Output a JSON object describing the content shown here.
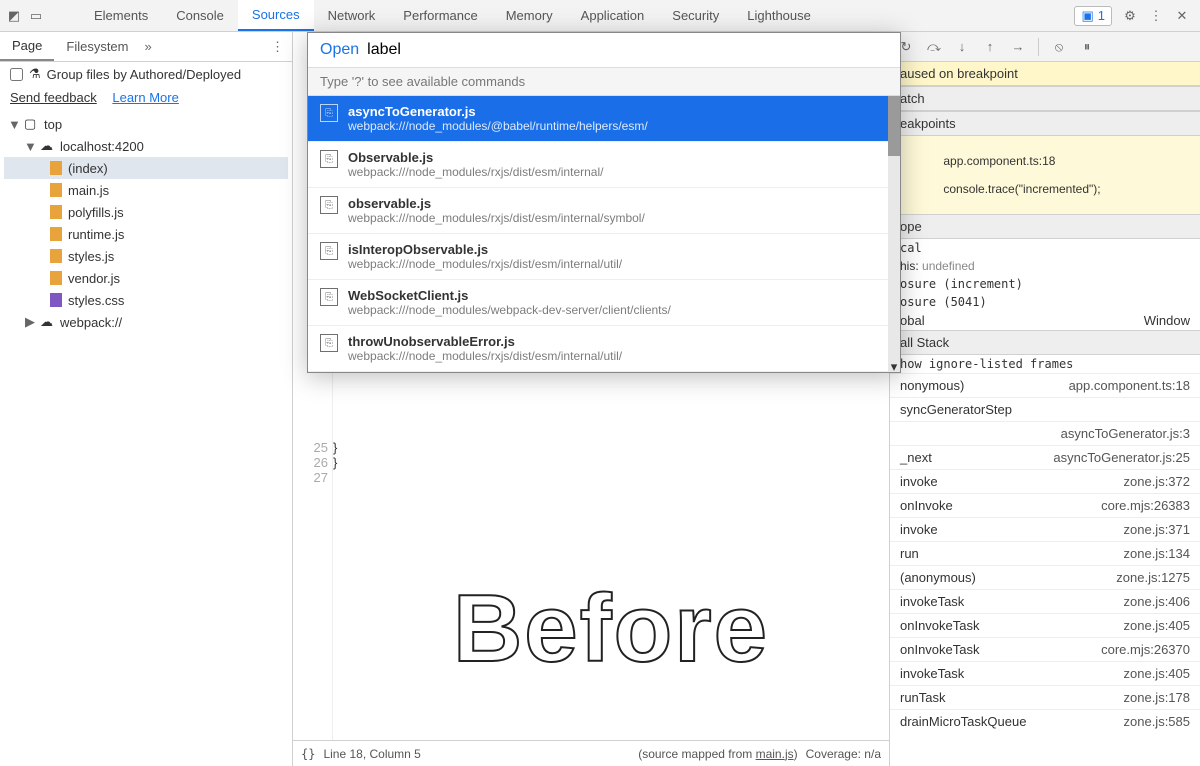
{
  "topbar": {
    "tabs": [
      "Elements",
      "Console",
      "Sources",
      "Network",
      "Performance",
      "Memory",
      "Application",
      "Security",
      "Lighthouse"
    ],
    "active": "Sources",
    "issues_count": "1"
  },
  "sidebar": {
    "tabs": [
      "Page",
      "Filesystem"
    ],
    "active": "Page",
    "group_label": "Group files by Authored/Deployed",
    "feedback": "Send feedback",
    "learn_more": "Learn More",
    "tree": {
      "top": "top",
      "host": "localhost:4200",
      "files": [
        "(index)",
        "main.js",
        "polyfills.js",
        "runtime.js",
        "styles.js",
        "vendor.js",
        "styles.css"
      ],
      "webpack": "webpack://"
    }
  },
  "palette": {
    "open_label": "Open",
    "query": "label",
    "hint": "Type '?' to see available commands",
    "items": [
      {
        "title": "asyncToGenerator.js",
        "path": "webpack:///node_modules/@babel/runtime/helpers/esm/",
        "selected": true
      },
      {
        "title": "Observable.js",
        "path": "webpack:///node_modules/rxjs/dist/esm/internal/"
      },
      {
        "title": "observable.js",
        "path": "webpack:///node_modules/rxjs/dist/esm/internal/symbol/"
      },
      {
        "title": "isInteropObservable.js",
        "path": "webpack:///node_modules/rxjs/dist/esm/internal/util/"
      },
      {
        "title": "WebSocketClient.js",
        "path": "webpack:///node_modules/webpack-dev-server/client/clients/"
      },
      {
        "title": "throwUnobservableError.js",
        "path": "webpack:///node_modules/rxjs/dist/esm/internal/util/"
      }
    ]
  },
  "editor": {
    "lines_visible": [
      "25",
      "26",
      "27"
    ],
    "line25": "  }",
    "line26": "}",
    "overlay_word": "Before"
  },
  "status": {
    "pretty": "{}",
    "pos": "Line 18, Column 5",
    "mapped": "(source mapped from ",
    "mapped_link": "main.js",
    "mapped_close": ")",
    "coverage": "Coverage: n/a"
  },
  "debug": {
    "paused": "aused on breakpoint",
    "watch": "atch",
    "breakpoints_h": "eakpoints",
    "bp_line1": "app.component.ts:18",
    "bp_line2": "console.trace(\"incremented\");",
    "scope_h": "ope",
    "scope_local": "cal",
    "scope_this_k": "his: ",
    "scope_this_v": "undefined",
    "scope_c1": "osure (increment)",
    "scope_c2": "osure (5041)",
    "scope_global_k": "obal",
    "scope_global_v": "Window",
    "callstack_h": "all Stack",
    "show_ignored": "how ignore-listed frames",
    "stack": [
      {
        "fn": "nonymous)",
        "loc": "app.component.ts:18"
      },
      {
        "fn": "syncGeneratorStep",
        "loc": ""
      },
      {
        "fn": "",
        "loc": "asyncToGenerator.js:3"
      },
      {
        "fn": "_next",
        "loc": "asyncToGenerator.js:25"
      },
      {
        "fn": "invoke",
        "loc": "zone.js:372"
      },
      {
        "fn": "onInvoke",
        "loc": "core.mjs:26383"
      },
      {
        "fn": "invoke",
        "loc": "zone.js:371"
      },
      {
        "fn": "run",
        "loc": "zone.js:134"
      },
      {
        "fn": "(anonymous)",
        "loc": "zone.js:1275"
      },
      {
        "fn": "invokeTask",
        "loc": "zone.js:406"
      },
      {
        "fn": "onInvokeTask",
        "loc": "zone.js:405"
      },
      {
        "fn": "onInvokeTask",
        "loc": "core.mjs:26370"
      },
      {
        "fn": "invokeTask",
        "loc": "zone.js:405"
      },
      {
        "fn": "runTask",
        "loc": "zone.js:178"
      },
      {
        "fn": "drainMicroTaskQueue",
        "loc": "zone.js:585"
      }
    ]
  }
}
